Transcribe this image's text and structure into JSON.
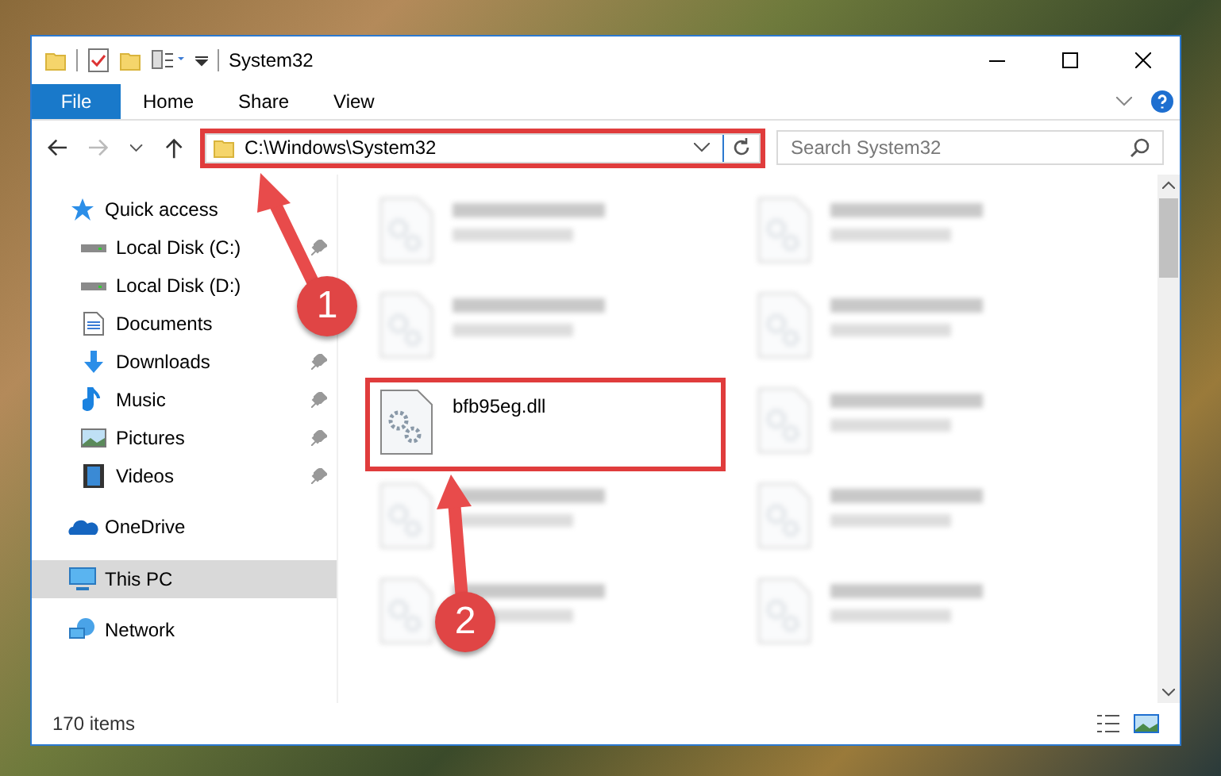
{
  "window": {
    "title": "System32"
  },
  "ribbon_tabs": [
    {
      "label": "File",
      "selected": true
    },
    {
      "label": "Home",
      "selected": false
    },
    {
      "label": "Share",
      "selected": false
    },
    {
      "label": "View",
      "selected": false
    }
  ],
  "address": {
    "path": "C:\\Windows\\System32"
  },
  "search": {
    "placeholder": "Search System32"
  },
  "sidebar": {
    "items": [
      {
        "label": "Quick access",
        "kind": "star",
        "pinned": false,
        "selected": false
      },
      {
        "label": "Local Disk (C:)",
        "kind": "drive",
        "pinned": true,
        "selected": false
      },
      {
        "label": "Local Disk (D:)",
        "kind": "drive",
        "pinned": false,
        "selected": false
      },
      {
        "label": "Documents",
        "kind": "document",
        "pinned": false,
        "selected": false
      },
      {
        "label": "Downloads",
        "kind": "download",
        "pinned": true,
        "selected": false
      },
      {
        "label": "Music",
        "kind": "music",
        "pinned": true,
        "selected": false
      },
      {
        "label": "Pictures",
        "kind": "picture",
        "pinned": true,
        "selected": false
      },
      {
        "label": "Videos",
        "kind": "video",
        "pinned": true,
        "selected": false
      },
      {
        "label": "OneDrive",
        "kind": "cloud",
        "pinned": false,
        "selected": false
      },
      {
        "label": "This PC",
        "kind": "pc",
        "pinned": false,
        "selected": true
      },
      {
        "label": "Network",
        "kind": "network",
        "pinned": false,
        "selected": false
      }
    ]
  },
  "address_highlighted": true,
  "files": [
    {
      "blurred": true
    },
    {
      "blurred": true
    },
    {
      "blurred": true
    },
    {
      "blurred": true
    },
    {
      "name": "bfb95eg.dll",
      "blurred": false,
      "highlighted": true
    },
    {
      "blurred": true
    },
    {
      "blurred": true
    },
    {
      "blurred": true
    },
    {
      "blurred": true
    },
    {
      "blurred": true
    }
  ],
  "status_bar": {
    "count": "170 items"
  },
  "annotations": [
    {
      "label": "1"
    },
    {
      "label": "2"
    }
  ]
}
